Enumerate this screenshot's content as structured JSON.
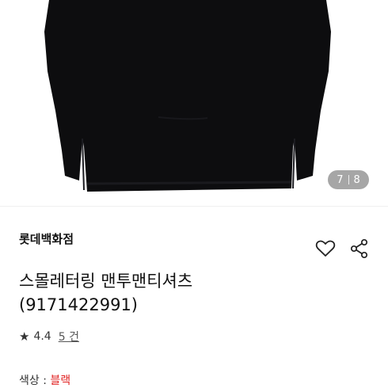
{
  "image_viewer": {
    "current": "7",
    "total": "8"
  },
  "product": {
    "brand": "롯데백화점",
    "title_line1": "스몰레터링 맨투맨티셔츠",
    "title_line2": "(9171422991)",
    "rating": "4.4",
    "review_count": "5 건",
    "color_label": "색상 : ",
    "color_value": "블랙"
  },
  "icons": {
    "wishlist": "heart-outline-icon",
    "share": "share-icon",
    "rating": "star-icon"
  },
  "colors": {
    "accent_red": "#e02020",
    "text": "#111111",
    "garment": "#0d0d0f"
  }
}
